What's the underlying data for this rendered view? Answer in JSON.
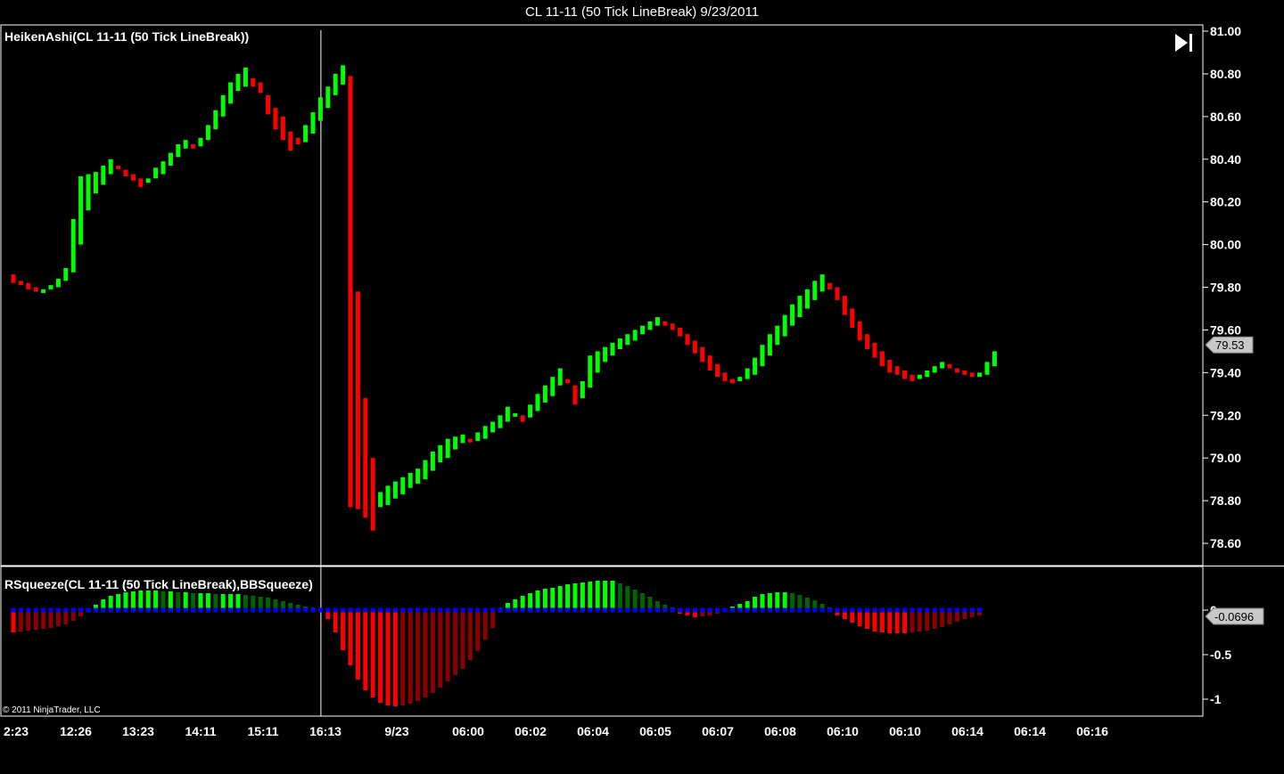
{
  "window": {
    "title": "CL 11-11 (50 Tick LineBreak)  9/23/2011",
    "copyright": "© 2011 NinjaTrader, LLC"
  },
  "colors": {
    "background": "#000000",
    "up": "#00ff00",
    "down": "#ff0000",
    "dark_up": "#006400",
    "dark_down": "#8b0000",
    "zero_dots": "#0000ff",
    "grid_text": "#ffffff"
  },
  "icons": {
    "scroll_end": "skip-to-end-icon"
  },
  "chart_data": [
    {
      "type": "candlestick",
      "title": "HeikenAshi(CL 11-11 (50 Tick LineBreak))",
      "ylim": [
        78.5,
        81.0
      ],
      "y_ticks": [
        "81.00",
        "80.80",
        "80.60",
        "80.40",
        "80.20",
        "80.00",
        "79.80",
        "79.60",
        "79.40",
        "79.20",
        "79.00",
        "78.80",
        "78.60"
      ],
      "current_price": "79.53",
      "x_ticks": [
        "2:23",
        "12:26",
        "13:23",
        "14:11",
        "15:11",
        "16:13",
        "9/23",
        "06:00",
        "06:02",
        "06:04",
        "06:05",
        "06:07",
        "06:08",
        "06:10",
        "06:10",
        "06:14",
        "06:14",
        "06:16"
      ],
      "session_divider_index": 41,
      "candles": [
        {
          "o": 79.86,
          "c": 79.82,
          "dir": "down"
        },
        {
          "o": 79.83,
          "c": 79.81,
          "dir": "down"
        },
        {
          "o": 79.82,
          "c": 79.79,
          "dir": "down"
        },
        {
          "o": 79.8,
          "c": 79.78,
          "dir": "down"
        },
        {
          "o": 79.78,
          "c": 79.79,
          "dir": "up"
        },
        {
          "o": 79.79,
          "c": 79.81,
          "dir": "up"
        },
        {
          "o": 79.8,
          "c": 79.84,
          "dir": "up"
        },
        {
          "o": 79.83,
          "c": 79.89,
          "dir": "up"
        },
        {
          "o": 79.87,
          "c": 80.12,
          "dir": "up"
        },
        {
          "o": 80.0,
          "c": 80.32,
          "dir": "up"
        },
        {
          "o": 80.16,
          "c": 80.33,
          "dir": "up"
        },
        {
          "o": 80.24,
          "c": 80.34,
          "dir": "up"
        },
        {
          "o": 80.28,
          "c": 80.37,
          "dir": "up"
        },
        {
          "o": 80.33,
          "c": 80.4,
          "dir": "up"
        },
        {
          "o": 80.37,
          "c": 80.36,
          "dir": "down"
        },
        {
          "o": 80.35,
          "c": 80.32,
          "dir": "down"
        },
        {
          "o": 80.33,
          "c": 80.3,
          "dir": "down"
        },
        {
          "o": 80.31,
          "c": 80.27,
          "dir": "down"
        },
        {
          "o": 80.29,
          "c": 80.31,
          "dir": "up"
        },
        {
          "o": 80.31,
          "c": 80.36,
          "dir": "up"
        },
        {
          "o": 80.33,
          "c": 80.39,
          "dir": "up"
        },
        {
          "o": 80.37,
          "c": 80.43,
          "dir": "up"
        },
        {
          "o": 80.41,
          "c": 80.47,
          "dir": "up"
        },
        {
          "o": 80.45,
          "c": 80.49,
          "dir": "up"
        },
        {
          "o": 80.47,
          "c": 80.45,
          "dir": "down"
        },
        {
          "o": 80.46,
          "c": 80.5,
          "dir": "up"
        },
        {
          "o": 80.49,
          "c": 80.56,
          "dir": "up"
        },
        {
          "o": 80.54,
          "c": 80.63,
          "dir": "up"
        },
        {
          "o": 80.6,
          "c": 80.7,
          "dir": "up"
        },
        {
          "o": 80.66,
          "c": 80.76,
          "dir": "up"
        },
        {
          "o": 80.72,
          "c": 80.8,
          "dir": "up"
        },
        {
          "o": 80.74,
          "c": 80.83,
          "dir": "up"
        },
        {
          "o": 80.78,
          "c": 80.74,
          "dir": "down"
        },
        {
          "o": 80.76,
          "c": 80.71,
          "dir": "down"
        },
        {
          "o": 80.7,
          "c": 80.61,
          "dir": "down"
        },
        {
          "o": 80.64,
          "c": 80.54,
          "dir": "down"
        },
        {
          "o": 80.6,
          "c": 80.49,
          "dir": "down"
        },
        {
          "o": 80.53,
          "c": 80.44,
          "dir": "down"
        },
        {
          "o": 80.5,
          "c": 80.47,
          "dir": "down"
        },
        {
          "o": 80.48,
          "c": 80.56,
          "dir": "up"
        },
        {
          "o": 80.52,
          "c": 80.62,
          "dir": "up"
        },
        {
          "o": 80.58,
          "c": 80.69,
          "dir": "up"
        },
        {
          "o": 80.64,
          "c": 80.74,
          "dir": "up"
        },
        {
          "o": 80.7,
          "c": 80.8,
          "dir": "up"
        },
        {
          "o": 80.75,
          "c": 80.84,
          "dir": "up"
        },
        {
          "o": 80.79,
          "c": 78.77,
          "dir": "down"
        },
        {
          "o": 79.78,
          "c": 78.76,
          "dir": "down"
        },
        {
          "o": 79.28,
          "c": 78.72,
          "dir": "down"
        },
        {
          "o": 79.0,
          "c": 78.66,
          "dir": "down"
        },
        {
          "o": 78.77,
          "c": 78.84,
          "dir": "up"
        },
        {
          "o": 78.78,
          "c": 78.87,
          "dir": "up"
        },
        {
          "o": 78.81,
          "c": 78.89,
          "dir": "up"
        },
        {
          "o": 78.83,
          "c": 78.91,
          "dir": "up"
        },
        {
          "o": 78.86,
          "c": 78.93,
          "dir": "up"
        },
        {
          "o": 78.88,
          "c": 78.95,
          "dir": "up"
        },
        {
          "o": 78.9,
          "c": 78.99,
          "dir": "up"
        },
        {
          "o": 78.94,
          "c": 79.03,
          "dir": "up"
        },
        {
          "o": 78.98,
          "c": 79.06,
          "dir": "up"
        },
        {
          "o": 79.0,
          "c": 79.09,
          "dir": "up"
        },
        {
          "o": 79.04,
          "c": 79.1,
          "dir": "up"
        },
        {
          "o": 79.07,
          "c": 79.11,
          "dir": "up"
        },
        {
          "o": 79.09,
          "c": 79.08,
          "dir": "down"
        },
        {
          "o": 79.08,
          "c": 79.12,
          "dir": "up"
        },
        {
          "o": 79.09,
          "c": 79.15,
          "dir": "up"
        },
        {
          "o": 79.12,
          "c": 79.17,
          "dir": "up"
        },
        {
          "o": 79.14,
          "c": 79.2,
          "dir": "up"
        },
        {
          "o": 79.17,
          "c": 79.24,
          "dir": "up"
        },
        {
          "o": 79.21,
          "c": 79.21,
          "dir": "up"
        },
        {
          "o": 79.2,
          "c": 79.17,
          "dir": "down"
        },
        {
          "o": 79.19,
          "c": 79.25,
          "dir": "up"
        },
        {
          "o": 79.22,
          "c": 79.3,
          "dir": "up"
        },
        {
          "o": 79.26,
          "c": 79.34,
          "dir": "up"
        },
        {
          "o": 79.29,
          "c": 79.38,
          "dir": "up"
        },
        {
          "o": 79.34,
          "c": 79.42,
          "dir": "up"
        },
        {
          "o": 79.37,
          "c": 79.35,
          "dir": "down"
        },
        {
          "o": 79.34,
          "c": 79.25,
          "dir": "down"
        },
        {
          "o": 79.28,
          "c": 79.36,
          "dir": "up"
        },
        {
          "o": 79.33,
          "c": 79.48,
          "dir": "up"
        },
        {
          "o": 79.4,
          "c": 79.5,
          "dir": "up"
        },
        {
          "o": 79.45,
          "c": 79.52,
          "dir": "up"
        },
        {
          "o": 79.48,
          "c": 79.54,
          "dir": "up"
        },
        {
          "o": 79.51,
          "c": 79.56,
          "dir": "up"
        },
        {
          "o": 79.53,
          "c": 79.58,
          "dir": "up"
        },
        {
          "o": 79.55,
          "c": 79.6,
          "dir": "up"
        },
        {
          "o": 79.58,
          "c": 79.62,
          "dir": "up"
        },
        {
          "o": 79.6,
          "c": 79.64,
          "dir": "up"
        },
        {
          "o": 79.62,
          "c": 79.66,
          "dir": "up"
        },
        {
          "o": 79.64,
          "c": 79.62,
          "dir": "down"
        },
        {
          "o": 79.63,
          "c": 79.6,
          "dir": "down"
        },
        {
          "o": 79.61,
          "c": 79.57,
          "dir": "down"
        },
        {
          "o": 79.58,
          "c": 79.53,
          "dir": "down"
        },
        {
          "o": 79.55,
          "c": 79.49,
          "dir": "down"
        },
        {
          "o": 79.52,
          "c": 79.45,
          "dir": "down"
        },
        {
          "o": 79.48,
          "c": 79.41,
          "dir": "down"
        },
        {
          "o": 79.44,
          "c": 79.38,
          "dir": "down"
        },
        {
          "o": 79.4,
          "c": 79.36,
          "dir": "down"
        },
        {
          "o": 79.37,
          "c": 79.35,
          "dir": "down"
        },
        {
          "o": 79.36,
          "c": 79.38,
          "dir": "up"
        },
        {
          "o": 79.37,
          "c": 79.42,
          "dir": "up"
        },
        {
          "o": 79.39,
          "c": 79.47,
          "dir": "up"
        },
        {
          "o": 79.43,
          "c": 79.53,
          "dir": "up"
        },
        {
          "o": 79.48,
          "c": 79.58,
          "dir": "up"
        },
        {
          "o": 79.53,
          "c": 79.62,
          "dir": "up"
        },
        {
          "o": 79.57,
          "c": 79.67,
          "dir": "up"
        },
        {
          "o": 79.62,
          "c": 79.72,
          "dir": "up"
        },
        {
          "o": 79.66,
          "c": 79.76,
          "dir": "up"
        },
        {
          "o": 79.7,
          "c": 79.79,
          "dir": "up"
        },
        {
          "o": 79.74,
          "c": 79.83,
          "dir": "up"
        },
        {
          "o": 79.78,
          "c": 79.86,
          "dir": "up"
        },
        {
          "o": 79.82,
          "c": 79.79,
          "dir": "down"
        },
        {
          "o": 79.8,
          "c": 79.74,
          "dir": "down"
        },
        {
          "o": 79.76,
          "c": 79.67,
          "dir": "down"
        },
        {
          "o": 79.7,
          "c": 79.61,
          "dir": "down"
        },
        {
          "o": 79.64,
          "c": 79.55,
          "dir": "down"
        },
        {
          "o": 79.58,
          "c": 79.51,
          "dir": "down"
        },
        {
          "o": 79.54,
          "c": 79.47,
          "dir": "down"
        },
        {
          "o": 79.5,
          "c": 79.43,
          "dir": "down"
        },
        {
          "o": 79.46,
          "c": 79.4,
          "dir": "down"
        },
        {
          "o": 79.43,
          "c": 79.39,
          "dir": "down"
        },
        {
          "o": 79.41,
          "c": 79.37,
          "dir": "down"
        },
        {
          "o": 79.39,
          "c": 79.36,
          "dir": "down"
        },
        {
          "o": 79.37,
          "c": 79.39,
          "dir": "up"
        },
        {
          "o": 79.38,
          "c": 79.41,
          "dir": "up"
        },
        {
          "o": 79.4,
          "c": 79.43,
          "dir": "up"
        },
        {
          "o": 79.42,
          "c": 79.45,
          "dir": "up"
        },
        {
          "o": 79.44,
          "c": 79.42,
          "dir": "down"
        },
        {
          "o": 79.42,
          "c": 79.4,
          "dir": "down"
        },
        {
          "o": 79.41,
          "c": 79.39,
          "dir": "down"
        },
        {
          "o": 79.4,
          "c": 79.38,
          "dir": "down"
        },
        {
          "o": 79.38,
          "c": 79.4,
          "dir": "up"
        },
        {
          "o": 79.39,
          "c": 79.45,
          "dir": "up"
        },
        {
          "o": 79.43,
          "c": 79.5,
          "dir": "up"
        }
      ]
    },
    {
      "type": "bar",
      "title": "RSqueeze(CL 11-11 (50 Tick LineBreak),BBSqueeze)",
      "ylim": [
        -1.15,
        0.2
      ],
      "y_ticks": [
        {
          "v": 0,
          "label": "0"
        },
        {
          "v": -0.5,
          "label": "-0.5"
        },
        {
          "v": -1,
          "label": "-1"
        }
      ],
      "current_value": "-0.0696",
      "values": [
        -0.25,
        -0.24,
        -0.23,
        -0.22,
        -0.21,
        -0.2,
        -0.18,
        -0.16,
        -0.12,
        -0.07,
        0.02,
        0.06,
        0.12,
        0.16,
        0.18,
        0.2,
        0.21,
        0.22,
        0.22,
        0.22,
        0.21,
        0.21,
        0.2,
        0.2,
        0.19,
        0.19,
        0.19,
        0.18,
        0.18,
        0.18,
        0.18,
        0.17,
        0.16,
        0.15,
        0.14,
        0.12,
        0.1,
        0.08,
        0.06,
        0.04,
        0.03,
        0.02,
        -0.1,
        -0.25,
        -0.45,
        -0.62,
        -0.78,
        -0.9,
        -0.98,
        -1.04,
        -1.07,
        -1.08,
        -1.07,
        -1.05,
        -1.02,
        -0.98,
        -0.93,
        -0.87,
        -0.8,
        -0.73,
        -0.66,
        -0.56,
        -0.46,
        -0.33,
        -0.2,
        0.03,
        0.08,
        0.12,
        0.16,
        0.19,
        0.22,
        0.24,
        0.25,
        0.27,
        0.29,
        0.3,
        0.31,
        0.32,
        0.33,
        0.33,
        0.33,
        0.3,
        0.27,
        0.23,
        0.19,
        0.15,
        0.1,
        0.06,
        0.03,
        -0.04,
        -0.06,
        -0.08,
        -0.07,
        -0.06,
        -0.04,
        0.02,
        0.04,
        0.07,
        0.1,
        0.15,
        0.18,
        0.19,
        0.2,
        0.2,
        0.19,
        0.17,
        0.14,
        0.11,
        0.07,
        0.03,
        -0.06,
        -0.1,
        -0.14,
        -0.18,
        -0.21,
        -0.24,
        -0.25,
        -0.26,
        -0.26,
        -0.26,
        -0.25,
        -0.24,
        -0.23,
        -0.21,
        -0.19,
        -0.16,
        -0.13,
        -0.1,
        -0.08,
        -0.06
      ],
      "squeeze_dots": "zero line markers"
    }
  ]
}
